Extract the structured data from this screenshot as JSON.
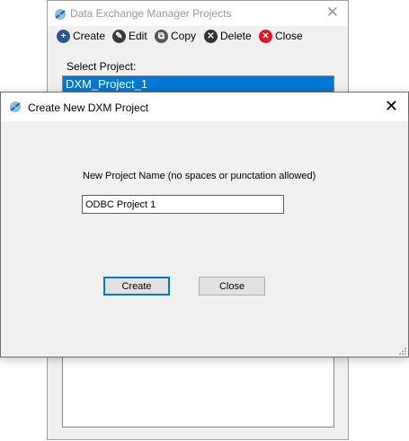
{
  "background_window": {
    "title": "Data Exchange Manager Projects",
    "toolbar": {
      "create": "Create",
      "edit": "Edit",
      "copy": "Copy",
      "delete": "Delete",
      "close": "Close"
    },
    "select_label": "Select Project:",
    "projects": [
      "DXM_Project_1"
    ],
    "selected_project": "DXM_Project_1"
  },
  "dialog": {
    "title": "Create New DXM Project",
    "name_label": "New Project Name (no spaces or punctation allowed)",
    "name_value": "ODBC Project 1",
    "create_button": "Create",
    "close_button": "Close"
  },
  "colors": {
    "selection": "#0078d7",
    "create_icon": "#2b5797",
    "delete_icon": "#333333",
    "close_icon": "#e81123"
  }
}
